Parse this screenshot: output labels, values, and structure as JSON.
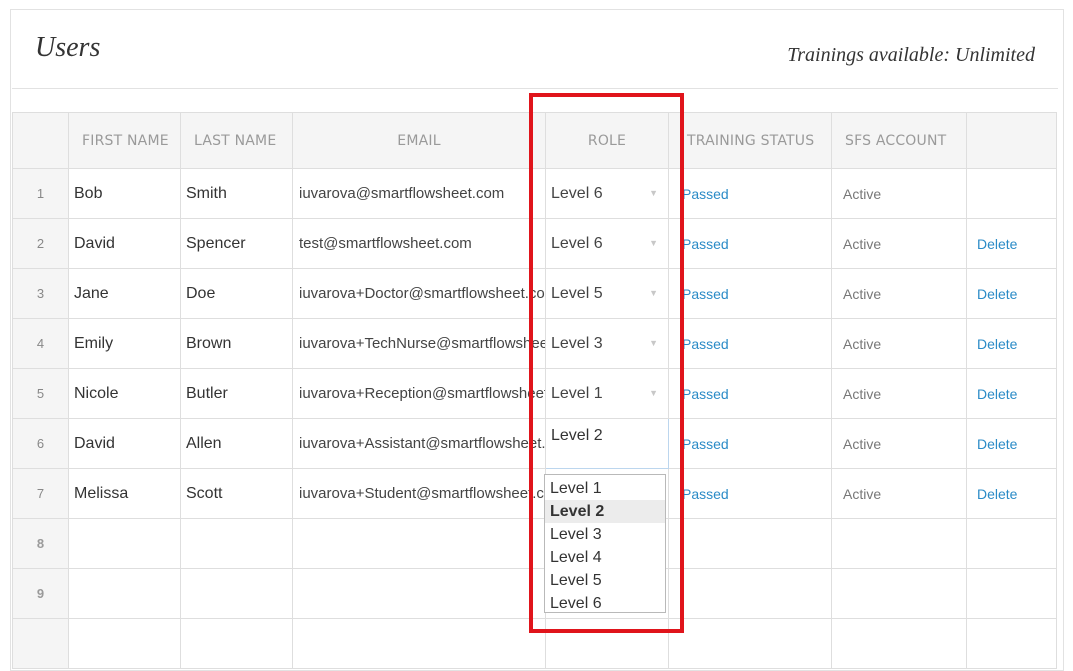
{
  "page": {
    "title": "Users",
    "trainings_label": "Trainings available: Unlimited"
  },
  "table": {
    "columns": {
      "first_name": "FIRST NAME",
      "last_name": "LAST NAME",
      "email": "EMAIL",
      "role": "ROLE",
      "training_status": "TRAINING STATUS",
      "sfs_account": "SFS ACCOUNT"
    },
    "rows": [
      {
        "num": "1",
        "first": "Bob",
        "last": "Smith",
        "email": "iuvarova@smartflowsheet.com",
        "role": "Level 6",
        "status": "Passed",
        "account": "Active",
        "action": ""
      },
      {
        "num": "2",
        "first": "David",
        "last": "Spencer",
        "email": "test@smartflowsheet.com",
        "role": "Level 6",
        "status": "Passed",
        "account": "Active",
        "action": "Delete"
      },
      {
        "num": "3",
        "first": "Jane",
        "last": "Doe",
        "email": "iuvarova+Doctor@smartflowsheet.com",
        "role": "Level 5",
        "status": "Passed",
        "account": "Active",
        "action": "Delete"
      },
      {
        "num": "4",
        "first": "Emily",
        "last": "Brown",
        "email": "iuvarova+TechNurse@smartflowsheet.com",
        "role": "Level 3",
        "status": "Passed",
        "account": "Active",
        "action": "Delete"
      },
      {
        "num": "5",
        "first": "Nicole",
        "last": "Butler",
        "email": "iuvarova+Reception@smartflowsheet.com",
        "role": "Level 1",
        "status": "Passed",
        "account": "Active",
        "action": "Delete"
      },
      {
        "num": "6",
        "first": "David",
        "last": "Allen",
        "email": "iuvarova+Assistant@smartflowsheet.com",
        "role": "Level 2",
        "status": "Passed",
        "account": "Active",
        "action": "Delete"
      },
      {
        "num": "7",
        "first": "Melissa",
        "last": "Scott",
        "email": "iuvarova+Student@smartflowsheet.com",
        "role": "",
        "status": "Passed",
        "account": "Active",
        "action": "Delete"
      }
    ],
    "empty_rows": [
      "8",
      "9",
      ""
    ]
  },
  "role_dropdown": {
    "options": [
      "Level 1",
      "Level 2",
      "Level 3",
      "Level 4",
      "Level 5",
      "Level 6"
    ],
    "selected_index": 1
  },
  "colors": {
    "link": "#2a8bc7",
    "highlight": "#e0141b",
    "header_bg": "#f5f5f5"
  }
}
